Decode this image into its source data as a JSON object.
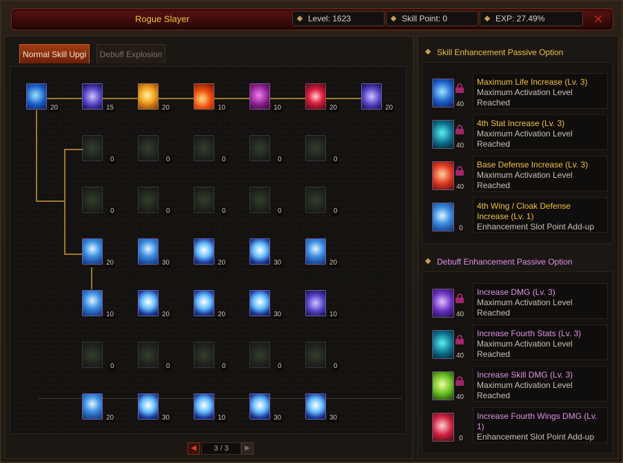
{
  "header": {
    "title": "Rogue Slayer",
    "level": "Level: 1623",
    "skill_point": "Skill Point: 0",
    "exp": "EXP:  27.49%"
  },
  "tabs": [
    {
      "label": "Normal Skill Upgi"
    },
    {
      "label": "Debuff Explosion"
    }
  ],
  "skill_tree": {
    "row1": [
      {
        "icon": "dash-icon",
        "level": "20"
      },
      {
        "icon": "vortex-icon",
        "level": "15"
      },
      {
        "icon": "burst-icon",
        "level": "20"
      },
      {
        "icon": "flame-icon",
        "level": "10"
      },
      {
        "icon": "shadow-icon",
        "level": "10"
      },
      {
        "icon": "blade-icon",
        "level": "20"
      },
      {
        "icon": "spear-icon",
        "level": "20"
      }
    ],
    "row2": [
      "0",
      "0",
      "0",
      "0",
      "0"
    ],
    "row3": [
      "0",
      "0",
      "0",
      "0",
      "0"
    ],
    "row4": [
      "20",
      "30",
      "20",
      "30",
      "20"
    ],
    "row5": [
      "10",
      "20",
      "20",
      "30",
      "10"
    ],
    "row6": [
      "0",
      "0",
      "0",
      "0",
      "0"
    ],
    "row7": [
      "20",
      "30",
      "10",
      "30",
      "30"
    ]
  },
  "pager": {
    "label": "3 / 3",
    "prev_glyph": "◀",
    "next_glyph": "▶"
  },
  "skill_enhancement": {
    "title": "Skill Enhancement Passive Option",
    "options": [
      {
        "name": "Maximum Life Increase (Lv. 3)",
        "desc": "Maximum Activation Level Reached",
        "num": "40",
        "icon": "skill-blue-icon"
      },
      {
        "name": "4th Stat Increase (Lv. 3)",
        "desc": "Maximum Activation Level Reached",
        "num": "40",
        "icon": "skill-teal-icon"
      },
      {
        "name": "Base Defense Increase (Lv. 3)",
        "desc": "Maximum Activation Level Reached",
        "num": "40",
        "icon": "skill-red-icon"
      },
      {
        "name": "4th Wing / Cloak Defense Increase (Lv. 1)",
        "desc": "Enhancement Slot Point Add-up",
        "num": "0",
        "icon": "wing-icon"
      }
    ]
  },
  "debuff_enhancement": {
    "title": "Debuff Enhancement Passive Option",
    "options": [
      {
        "name": "Increase DMG (Lv. 3)",
        "desc": "Maximum Activation Level Reached",
        "num": "40",
        "icon": "sword-icon"
      },
      {
        "name": "Increase Fourth Stats (Lv. 3)",
        "desc": "Maximum Activation Level Reached",
        "num": "40",
        "icon": "skill-teal-icon"
      },
      {
        "name": "Increase Skill DMG (Lv. 3)",
        "desc": "Maximum Activation Level Reached",
        "num": "40",
        "icon": "slash-icon"
      },
      {
        "name": "Increase Fourth Wings DMG (Lv. 1)",
        "desc": "Enhancement Slot Point Add-up",
        "num": "0",
        "icon": "red-wing-icon"
      }
    ]
  },
  "colors": {
    "gold": "#f0c04a",
    "pink": "#e090e8",
    "title_red": "#5a1410"
  }
}
